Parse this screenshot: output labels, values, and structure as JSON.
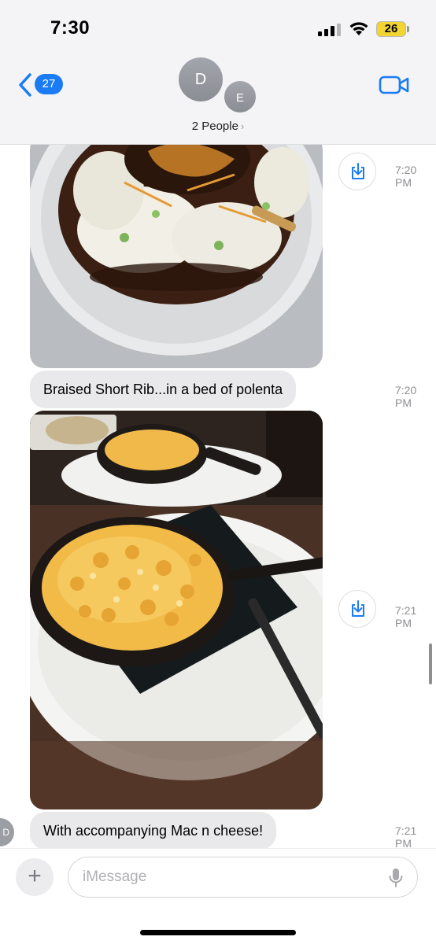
{
  "status_bar": {
    "time": "7:30",
    "battery": "26"
  },
  "header": {
    "back_badge": "27",
    "avatar_1": "D",
    "avatar_2": "E",
    "title": "2 People",
    "chevron": "›"
  },
  "messages": [
    {
      "type": "photo",
      "description_icon": "food-photo-short-rib",
      "time": "7:20 PM"
    },
    {
      "type": "text",
      "text": "Braised Short Rib...in a bed of polenta",
      "time": "7:20 PM"
    },
    {
      "type": "photo",
      "description_icon": "food-photo-mac-cheese",
      "time": "7:21 PM"
    },
    {
      "type": "text",
      "text": "With accompanying Mac n cheese!",
      "time": "7:21 PM"
    }
  ],
  "sender_avatar": "D",
  "compose": {
    "placeholder": "iMessage",
    "plus": "+"
  },
  "colors": {
    "accent": "#1a7cf5",
    "bubble": "#e9e9eb",
    "battery": "#f2d533"
  }
}
